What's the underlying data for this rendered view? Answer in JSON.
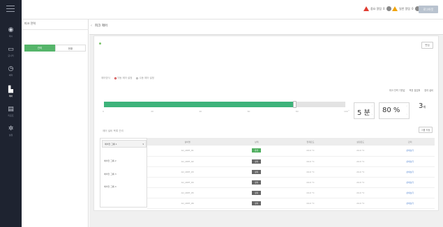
{
  "nav": {
    "items": [
      {
        "icon": "dashboard-icon",
        "label": "대시"
      },
      {
        "icon": "monitor-icon",
        "label": "모니터"
      },
      {
        "icon": "clock-icon",
        "label": "예약"
      },
      {
        "icon": "energy-control-icon",
        "label": "제어"
      },
      {
        "icon": "report-icon",
        "label": "리포트"
      },
      {
        "icon": "settings-icon",
        "label": "설정"
      }
    ]
  },
  "header": {
    "alert_critical_label": "중요 알림",
    "alert_critical_count": "0",
    "alert_warning_label": "일반 알림",
    "alert_warning_count": "0",
    "logout_label": "로그아웃"
  },
  "left_panel": {
    "title": "피크 전력",
    "tabs": [
      "관리",
      "현황"
    ]
  },
  "main": {
    "tab_label": "피크 제어",
    "edit_label": "편집",
    "method_label": "제어방식",
    "method_options": [
      "자동 제어 설정",
      "수동 제어 설정"
    ],
    "legend": [
      "피크 전력 기준값",
      "목표 절감률",
      "참여 설비"
    ],
    "slider_fraction": 0.79,
    "slider_ticks": [
      "0",
      "20",
      "40",
      "60",
      "80",
      "100"
    ],
    "interval_value": "5 분",
    "rate_value": "80 %",
    "count_value": "3",
    "count_unit": "개",
    "subhead": "제어 설비 목록 관리",
    "assign_label": "그룹 지정",
    "groups": {
      "selected": "에어컨 그룹 1",
      "items": [
        "에어컨 그룹 2",
        "에어컨 그룹 3",
        "에어컨 그룹 4"
      ]
    },
    "table": {
      "headers": [
        "설비명",
        "상태",
        "현재온도",
        "설정온도",
        "관리"
      ],
      "rows": [
        {
          "name": "AC_UNIT_01",
          "state": "운전",
          "state_on": true,
          "cur": "24.0 °C",
          "set": "24.0 °C",
          "action": "상세보기"
        },
        {
          "name": "AC_UNIT_02",
          "state": "정지",
          "state_on": false,
          "cur": "24.0 °C",
          "set": "24.0 °C",
          "action": "상세보기"
        },
        {
          "name": "AC_UNIT_03",
          "state": "정지",
          "state_on": false,
          "cur": "24.0 °C",
          "set": "24.0 °C",
          "action": "상세보기"
        },
        {
          "name": "AC_UNIT_04",
          "state": "정지",
          "state_on": false,
          "cur": "24.0 °C",
          "set": "24.0 °C",
          "action": "상세보기"
        },
        {
          "name": "AC_UNIT_05",
          "state": "정지",
          "state_on": false,
          "cur": "24.0 °C",
          "set": "24.0 °C",
          "action": "상세보기"
        },
        {
          "name": "AC_UNIT_06",
          "state": "정지",
          "state_on": false,
          "cur": "24.0 °C",
          "set": "24.0 °C",
          "action": "상세보기"
        }
      ]
    }
  },
  "colors": {
    "nav_bg": "#1e2330",
    "accent_green": "#3db37a",
    "alert_red": "#e03c31",
    "alert_orange": "#f0a30a"
  }
}
